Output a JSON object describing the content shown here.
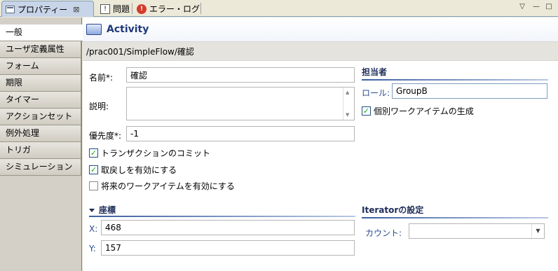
{
  "tabs": [
    {
      "label": "プロパティー",
      "close": "⊠"
    },
    {
      "label": "問題"
    },
    {
      "label": "エラー・ログ"
    }
  ],
  "window_controls": {
    "menu": "▽",
    "minimize": "—",
    "maximize": "□"
  },
  "sidebar": {
    "items": [
      {
        "label": "一般"
      },
      {
        "label": "ユーザ定義属性"
      },
      {
        "label": "フォーム"
      },
      {
        "label": "期限"
      },
      {
        "label": "タイマー"
      },
      {
        "label": "アクションセット"
      },
      {
        "label": "例外処理"
      },
      {
        "label": "トリガ"
      },
      {
        "label": "シミュレーション"
      }
    ]
  },
  "header": {
    "title": "Activity"
  },
  "path": "/prac001/SimpleFlow/確認",
  "general": {
    "name_label": "名前*:",
    "name_value": "確認",
    "desc_label": "説明:",
    "desc_value": "",
    "priority_label": "優先度*:",
    "priority_value": "-1"
  },
  "checks": [
    {
      "label": "トランザクションのコミット",
      "checked": true
    },
    {
      "label": "取戻しを有効にする",
      "checked": true
    },
    {
      "label": "将来のワークアイテムを有効にする",
      "checked": false
    }
  ],
  "assignee": {
    "section": "担当者",
    "role_label": "ロール:",
    "role_value": "GroupB",
    "individual_label": "個別ワークアイテムの生成",
    "individual_checked": true
  },
  "coords": {
    "section": "座標",
    "x_label": "X:",
    "x_value": "468",
    "y_label": "Y:",
    "y_value": "157"
  },
  "iterator": {
    "section": "Iteratorの設定",
    "count_label": "カウント:",
    "count_value": ""
  }
}
